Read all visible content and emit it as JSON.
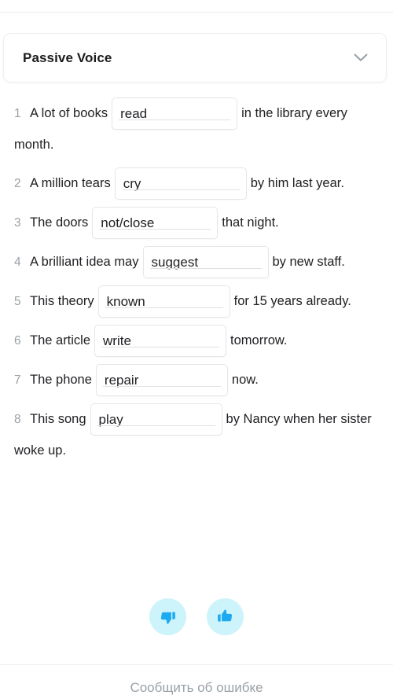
{
  "header": {
    "title": "Passive Voice",
    "chevron_icon": "chevron-down-icon"
  },
  "exercises": [
    {
      "number": "1",
      "before": "A lot of books",
      "input_value": "read",
      "after": "in the library every month."
    },
    {
      "number": "2",
      "before": "A million tears",
      "input_value": "cry",
      "after": "by him last year."
    },
    {
      "number": "3",
      "before": "The doors",
      "input_value": "not/close",
      "after": "that night."
    },
    {
      "number": "4",
      "before": "A brilliant idea may",
      "input_value": "suggest",
      "after": "by new staff."
    },
    {
      "number": "5",
      "before": "This theory",
      "input_value": "known",
      "after": "for 15 years already."
    },
    {
      "number": "6",
      "before": "The article",
      "input_value": "write",
      "after": "tomorrow."
    },
    {
      "number": "7",
      "before": "The phone",
      "input_value": "repair",
      "after": "now."
    },
    {
      "number": "8",
      "before": "This song",
      "input_value": "play",
      "after": "by Nancy when her sister woke up."
    }
  ],
  "feedback": {
    "dislike_icon": "thumbs-down-icon",
    "like_icon": "thumbs-up-icon",
    "button_bg": "#CDF4FA",
    "icon_color": "#1EAAF1"
  },
  "footer": {
    "report_label": "Сообщить об ошибке"
  }
}
